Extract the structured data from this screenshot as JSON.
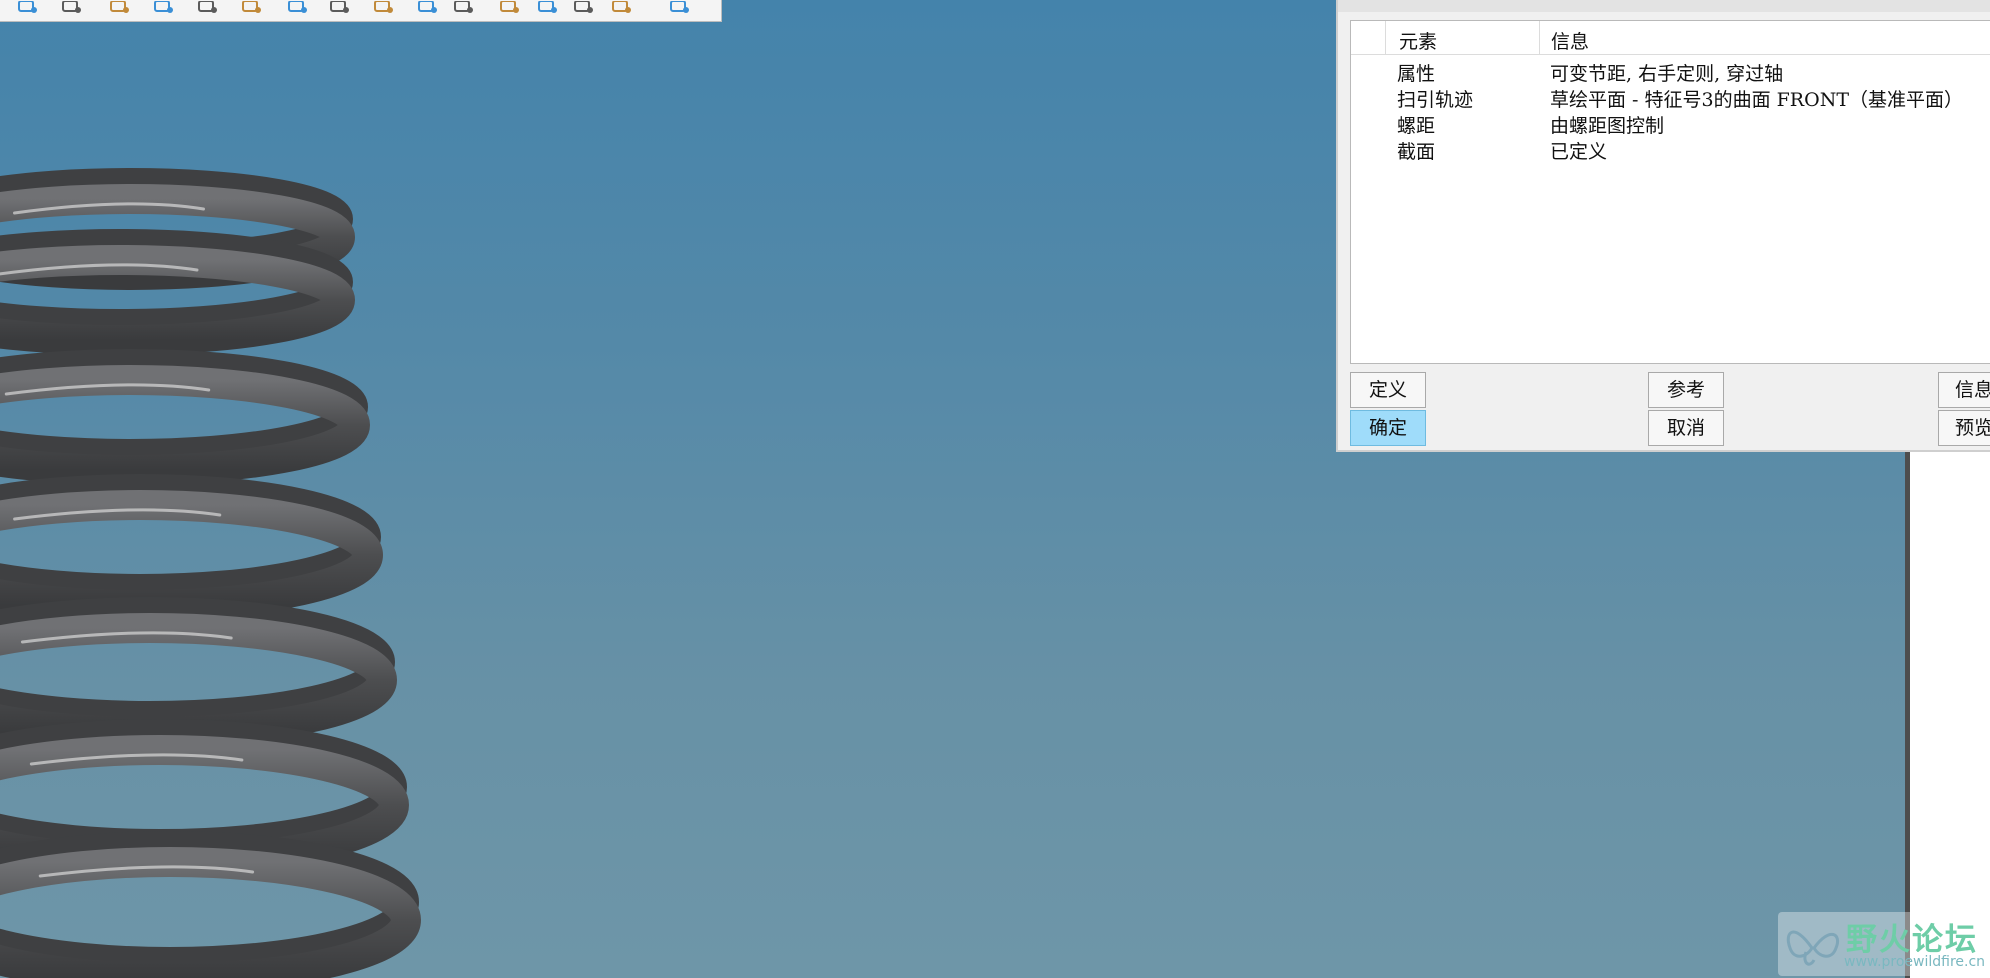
{
  "table": {
    "headers": {
      "element": "元素",
      "info": "信息"
    },
    "rows": [
      {
        "element": "属性",
        "info": "可变节距, 右手定则, 穿过轴"
      },
      {
        "element": "扫引轨迹",
        "info": "草绘平面 - 特征号3的曲面 FRONT（基准平面）"
      },
      {
        "element": "螺距",
        "info": "由螺距图控制"
      },
      {
        "element": "截面",
        "info": "已定义"
      }
    ]
  },
  "buttons": {
    "define": "定义",
    "ok": "确定",
    "refs": "参考",
    "cancel": "取消",
    "info": "信息",
    "preview": "预览"
  },
  "watermark": {
    "title": "野火论坛",
    "url": "www.proewildfire.cn"
  },
  "icons": [
    "shaded-view-icon",
    "view-manager-icon",
    "saved-views-icon",
    "screenshot-icon",
    "refit-icon",
    "perspective-icon",
    "datum-curve-icon",
    "datum-axis-icon",
    "datum-plane-icon",
    "datum-point-icon",
    "csys-icon",
    "annotation-icon",
    "spin-center-icon",
    "settings-icon",
    "grid-icon",
    "pointer-icon"
  ],
  "colors": {
    "viewport_top": "#4483ab",
    "viewport_bottom": "#6e96a8",
    "spring": "#505153",
    "ok_button": "#9fdcfa",
    "watermark": "#6ecda7"
  }
}
